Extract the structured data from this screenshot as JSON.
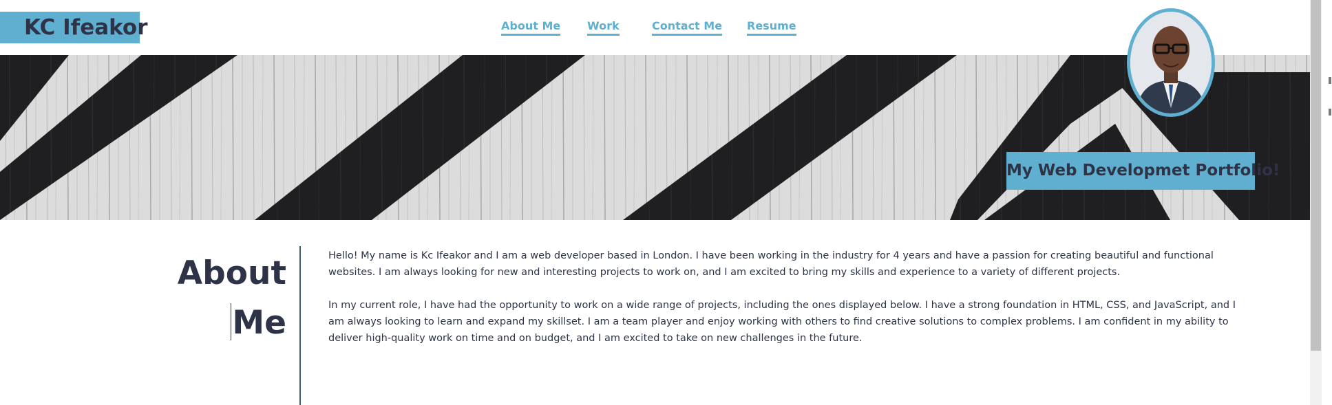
{
  "header": {
    "brand": "KC Ifeakor",
    "nav": [
      {
        "label": "About Me"
      },
      {
        "label": "Work"
      },
      {
        "label": "Contact Me"
      },
      {
        "label": "Resume"
      }
    ]
  },
  "hero": {
    "tagline": "My Web Developmet Portfolio!",
    "avatar_icon": "profile-photo"
  },
  "about": {
    "heading_line1": "About",
    "heading_line2": "Me",
    "paragraphs": [
      "Hello! My name is Kc Ifeakor and I am a web developer based in London. I have been working in the industry for 4 years and have a passion for creating beautiful and functional websites. I am always looking for new and interesting projects to work on, and I am excited to bring my skills and experience to a variety of different projects.",
      "In my current role, I have had the opportunity to work on a wide range of projects, including the ones displayed below. I have a strong foundation in HTML, CSS, and JavaScript, and I am always looking to learn and expand my skillset. I am a team player and enjoy working with others to find creative solutions to complex problems. I am confident in my ability to deliver high-quality work on time and on budget, and I am excited to take on new challenges in the future."
    ]
  },
  "colors": {
    "accent": "#5fb0d0",
    "text": "#2e3347",
    "divider": "#3d5a6e"
  }
}
